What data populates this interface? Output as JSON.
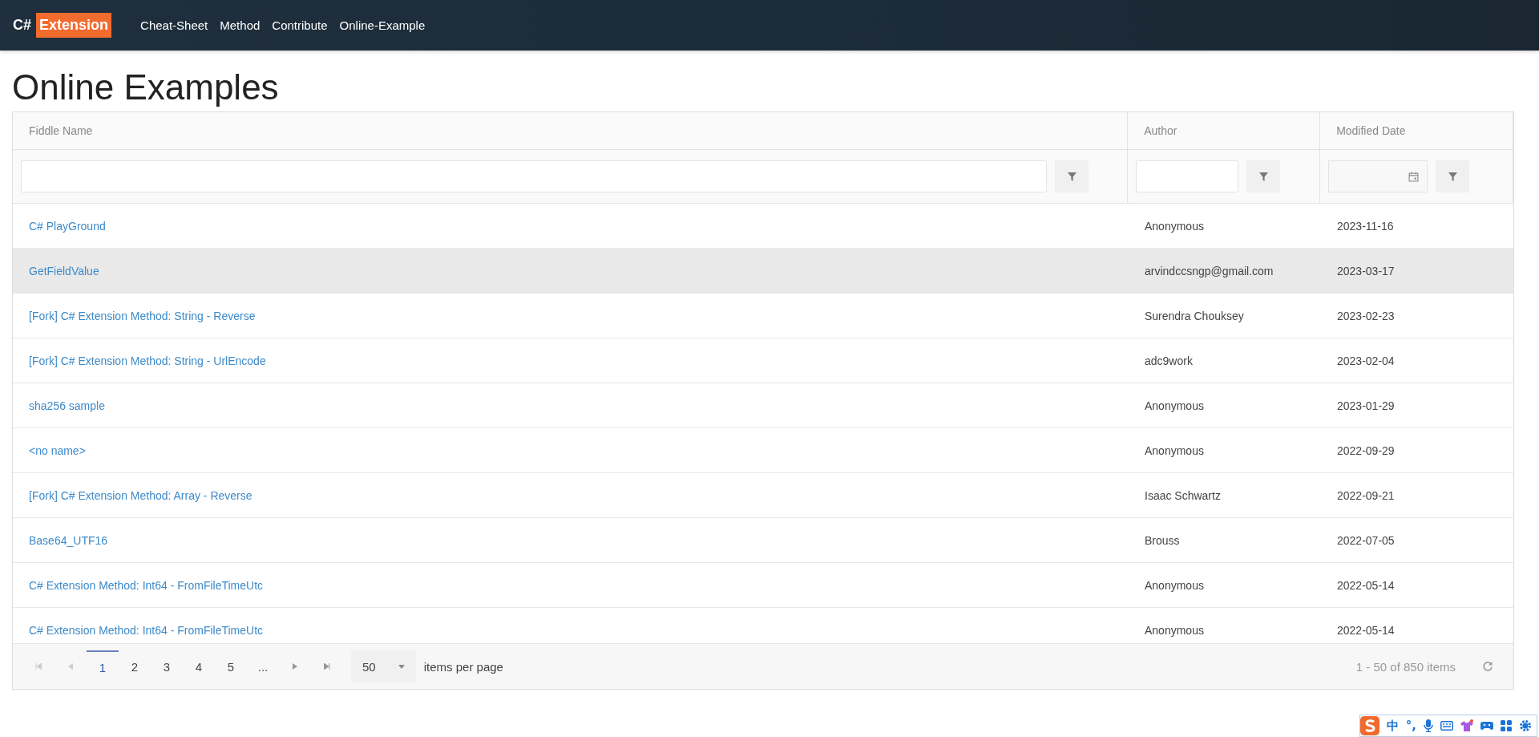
{
  "navbar": {
    "logo": {
      "prefix": "C#",
      "badge": "Extension"
    },
    "links": [
      "Cheat-Sheet",
      "Method",
      "Contribute",
      "Online-Example"
    ]
  },
  "page_title": "Online Examples",
  "table": {
    "columns": [
      "Fiddle Name",
      "Author",
      "Modified Date"
    ],
    "rows": [
      {
        "name": "C# PlayGround",
        "author": "Anonymous",
        "date": "2023-11-16",
        "selected": false
      },
      {
        "name": "GetFieldValue",
        "author": "arvindccsngp@gmail.com",
        "date": "2023-03-17",
        "selected": true
      },
      {
        "name": "[Fork] C# Extension Method: String - Reverse",
        "author": "Surendra Chouksey",
        "date": "2023-02-23",
        "selected": false
      },
      {
        "name": "[Fork] C# Extension Method: String - UrlEncode",
        "author": "adc9work",
        "date": "2023-02-04",
        "selected": false
      },
      {
        "name": "sha256 sample",
        "author": "Anonymous",
        "date": "2023-01-29",
        "selected": false
      },
      {
        "name": "<no name>",
        "author": "Anonymous",
        "date": "2022-09-29",
        "selected": false
      },
      {
        "name": "[Fork] C# Extension Method: Array - Reverse",
        "author": "Isaac Schwartz",
        "date": "2022-09-21",
        "selected": false
      },
      {
        "name": "Base64_UTF16",
        "author": "Brouss",
        "date": "2022-07-05",
        "selected": false
      },
      {
        "name": "C# Extension Method: Int64 - FromFileTimeUtc",
        "author": "Anonymous",
        "date": "2022-05-14",
        "selected": false
      },
      {
        "name": "C# Extension Method: Int64 - FromFileTimeUtc",
        "author": "Anonymous",
        "date": "2022-05-14",
        "selected": false
      }
    ]
  },
  "pager": {
    "pages": [
      {
        "label": "1",
        "selected": true
      },
      {
        "label": "2",
        "selected": false
      },
      {
        "label": "3",
        "selected": false
      },
      {
        "label": "4",
        "selected": false
      },
      {
        "label": "5",
        "selected": false
      },
      {
        "label": "...",
        "selected": false
      }
    ],
    "page_size": "50",
    "page_size_label": "items per page",
    "info": "1 - 50 of 850 items"
  },
  "ime_toolbar": {
    "mode": "中",
    "punctuation": "°,"
  }
}
